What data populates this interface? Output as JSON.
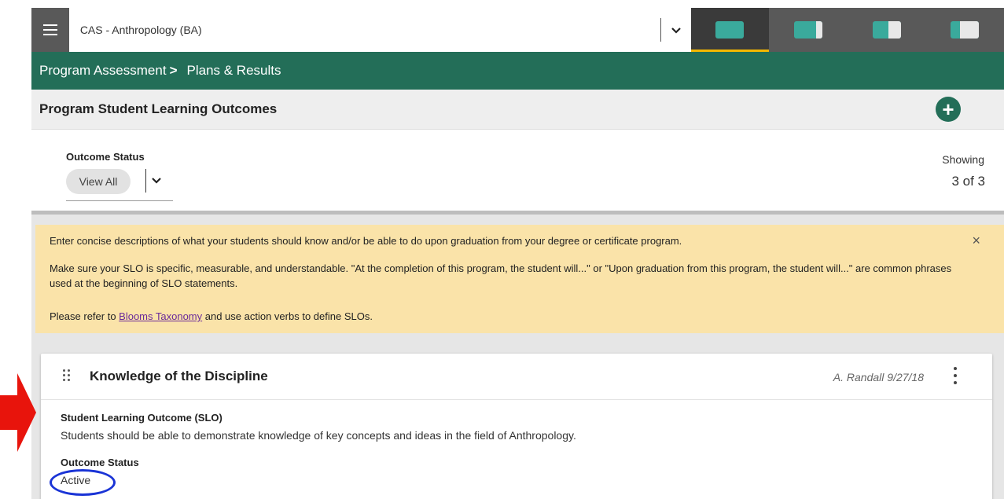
{
  "topbar": {
    "program": "CAS - Anthropology (BA)",
    "views": [
      {
        "icon": "layout-full-icon",
        "active": true
      },
      {
        "icon": "layout-split-small-icon",
        "active": false
      },
      {
        "icon": "layout-split-half-icon",
        "active": false
      },
      {
        "icon": "layout-split-large-icon",
        "active": false
      }
    ]
  },
  "breadcrumb": {
    "parent": "Program Assessment",
    "separator": ">",
    "current": "Plans & Results"
  },
  "section": {
    "title": "Program Student Learning Outcomes",
    "add_icon": "plus-circle-icon"
  },
  "filter": {
    "label": "Outcome Status",
    "value": "View All",
    "showing_label": "Showing",
    "showing_count": "3 of 3"
  },
  "banner": {
    "p1": "Enter concise descriptions of what your students should know and/or be able to do upon graduation from your degree or certificate program.",
    "p2": "Make sure your SLO is specific, measurable, and understandable. \"At the completion of this program, the student will...\" or \"Upon graduation from this program, the student will...\" are common phrases used at the beginning of SLO statements.",
    "p3_before": "Please refer to ",
    "p3_link": "Blooms Taxonomy",
    "p3_after": " and use action verbs to define SLOs.",
    "close": "×"
  },
  "card": {
    "title": "Knowledge of the Discipline",
    "meta": "A. Randall 9/27/18",
    "slo_label": "Student Learning Outcome (SLO)",
    "slo_text": "Students should be able to demonstrate knowledge of key concepts and ideas in the field of Anthropology.",
    "status_label": "Outcome Status",
    "status_value": "Active"
  },
  "annotations": {
    "arrow_color": "#e8140c",
    "circle_color": "#1a34d6"
  }
}
